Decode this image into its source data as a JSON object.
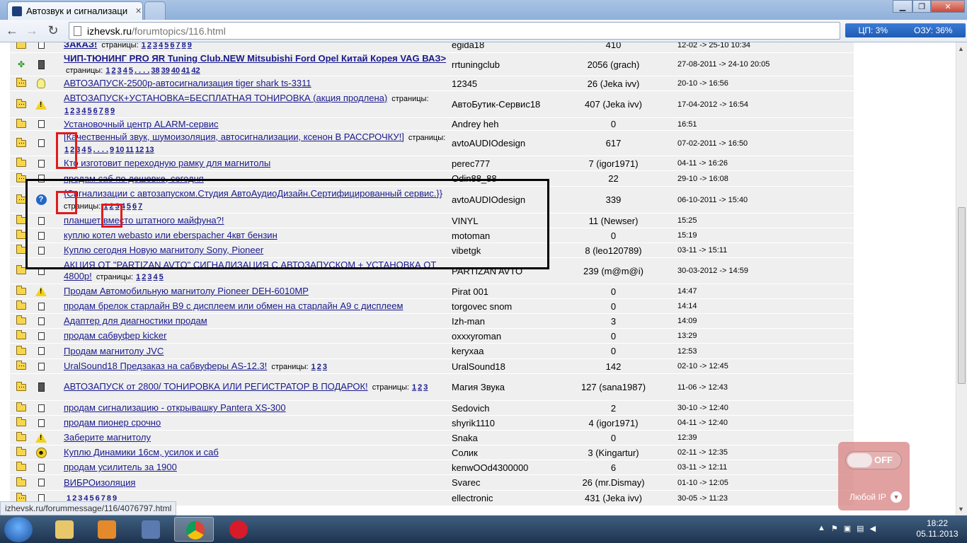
{
  "browser": {
    "tab_title": "Автозвук и сигнализаци",
    "url_host": "izhevsk.ru",
    "url_path": "/forumtopics/116.html"
  },
  "sysmon": {
    "cpu": "ЦП: 3%",
    "ram": "ОЗУ: 36%"
  },
  "rows": [
    {
      "fold": "folder",
      "icon": "doc",
      "title": "ЗАКАЗ!",
      "bold": true,
      "pages": [
        "1",
        "2",
        "3",
        "4",
        "5",
        "6",
        "7",
        "8",
        "9"
      ],
      "author": "egida18",
      "replies": "410",
      "date": "12-02 -> 25-10 10:34",
      "h": 22
    },
    {
      "fold": "clover",
      "icon": "phone",
      "title": "ЧИП-ТЮНИНГ PRO ЯR Tuning Club.NEW Mitsubishi Ford Opel Китай Корея VAG ВАЗ>",
      "bold": true,
      "pages": [
        "1",
        "2",
        "3",
        "4",
        "5",
        ". . . .",
        "38",
        "39",
        "40",
        "41",
        "42"
      ],
      "author": "rrtuningclub",
      "replies": "2056 (grach)",
      "date": "27-08-2011 -> 24-10 20:05",
      "h": 33
    },
    {
      "fold": "folder-dots",
      "icon": "bulb",
      "title": "АВТОЗАПУСК-2500р-автосигнализация tiger shark ts-3311",
      "bold": false,
      "pages": [],
      "author": "12345",
      "replies": "26 (Jeka ivv)",
      "date": "20-10 -> 16:56",
      "h": 21
    },
    {
      "fold": "folder-dots",
      "icon": "warn",
      "title": "АВТОЗАПУСК+УСТАНОВКА=БЕСПЛАТНАЯ ТОНИРОВКА (акция продлена)",
      "bold": false,
      "pages": [
        "1",
        "2",
        "3",
        "4",
        "5",
        "6",
        "7",
        "8",
        "9"
      ],
      "author": "АвтоБутик-Сервис18",
      "replies": "407 (Jeka ivv)",
      "date": "17-04-2012 -> 16:54",
      "h": 38
    },
    {
      "fold": "folder",
      "icon": "doc",
      "title": "Установочный центр ALARM-сервис",
      "bold": false,
      "pages": [],
      "author": "Andrey heh",
      "replies": "0",
      "date": "16:51",
      "h": 18
    },
    {
      "fold": "folder-dots",
      "icon": "doc",
      "title": "[Качественный звук, шумоизоляция, автосигнализации, ксенон В РАССРОЧКУ!]",
      "bold": false,
      "pages": [
        "1",
        "2",
        "3",
        "4",
        "5",
        ". . . .",
        "9",
        "10",
        "11",
        "12",
        "13"
      ],
      "author": "avtoAUDIOdesign",
      "replies": "617",
      "date": "07-02-2011 -> 16:50",
      "h": 36
    },
    {
      "fold": "folder",
      "icon": "doc",
      "title": "Кто изготовит переходную рамку для магнитолы",
      "bold": false,
      "pages": [],
      "author": "perec777",
      "replies": "7 (igor1971)",
      "date": "04-11 -> 16:26",
      "h": 21
    },
    {
      "fold": "folder-dots",
      "icon": "doc",
      "title": "продам саб по дешевке, сегодня",
      "bold": false,
      "pages": [],
      "author": "Odin88_88",
      "replies": "22",
      "date": "29-10 -> 16:08",
      "h": 22
    },
    {
      "fold": "folder-dots",
      "icon": "quest",
      "title": "{Сигнализации с автозапуском.Студия АвтоАудиоДизайн.Сертифицированный сервис.}}",
      "bold": false,
      "pages": [
        "1",
        "2",
        "3",
        "4",
        "5",
        "6",
        "7"
      ],
      "author": "avtoAUDIOdesign",
      "replies": "339",
      "date": "06-10-2011 -> 15:40",
      "h": 38
    },
    {
      "fold": "folder",
      "icon": "doc",
      "title": "планшет вместо штатного майфуна?!",
      "bold": false,
      "pages": [],
      "author": "VINYL",
      "replies": "11 (Newser)",
      "date": "15:25",
      "h": 21
    },
    {
      "fold": "folder",
      "icon": "doc",
      "title": "куплю котел webasto или eberspacher 4квт бензин",
      "bold": false,
      "pages": [],
      "author": "motoman",
      "replies": "0",
      "date": "15:19",
      "h": 21
    },
    {
      "fold": "folder",
      "icon": "doc",
      "title": "Куплю сегодня Новую магнитолу Sony, Pioneer",
      "bold": false,
      "pages": [],
      "author": "vibetgk",
      "replies": "8 (leo120789)",
      "date": "03-11 -> 15:11",
      "h": 21
    },
    {
      "fold": "folder",
      "icon": "doc",
      "title": "АКЦИЯ ОТ \"PARTIZAN AVTO\" СИГНАЛИЗАЦИЯ С АВТОЗАПУСКОМ + УСТАНОВКА ОТ 4800р!",
      "bold": false,
      "pages": [
        "1",
        "2",
        "3",
        "4",
        "5"
      ],
      "author": "PARTIZAN AVTO",
      "replies": "239 (m@m@i)",
      "date": "30-03-2012 -> 14:59",
      "h": 37
    },
    {
      "fold": "folder",
      "icon": "warn",
      "title": "Продам Автомобильную магнитолу Pioneer DEH-6010MP",
      "bold": false,
      "pages": [],
      "author": "Pirat 001",
      "replies": "0",
      "date": "14:47",
      "h": 21
    },
    {
      "fold": "folder",
      "icon": "doc",
      "title": "продам брелок старлайн В9 с дисплеем или обмен на старлайн А9 с дисплеем",
      "bold": false,
      "pages": [],
      "author": "torgovec snom",
      "replies": "0",
      "date": "14:14",
      "h": 21
    },
    {
      "fold": "folder",
      "icon": "doc",
      "title": "Адаптер для диагностики продам",
      "bold": false,
      "pages": [],
      "author": "Izh-man",
      "replies": "3",
      "date": "14:09",
      "h": 21
    },
    {
      "fold": "folder",
      "icon": "doc",
      "title": "продам сабвуфер kicker",
      "bold": false,
      "pages": [],
      "author": "oxxxyroman",
      "replies": "0",
      "date": "13:29",
      "h": 21
    },
    {
      "fold": "folder",
      "icon": "doc",
      "title": "Продам магнитолу JVC",
      "bold": false,
      "pages": [],
      "author": "keryxaa",
      "replies": "0",
      "date": "12:53",
      "h": 22
    },
    {
      "fold": "folder-dots",
      "icon": "doc",
      "title": "UralSound18 Предзаказ на сабвуферы AS-12.3!",
      "bold": false,
      "pages": [
        "1",
        "2",
        "3"
      ],
      "author": "UralSound18",
      "replies": "142",
      "date": "02-10 -> 12:45",
      "h": 21
    },
    {
      "fold": "folder-dots",
      "icon": "phone",
      "title": "АВТОЗАПУСК от 2800/ ТОНИРОВКА ИЛИ РЕГИСТРАТОР В ПОДАРОК!",
      "bold": false,
      "pages": [
        "1",
        "2",
        "3"
      ],
      "author": "Магия Звука",
      "replies": "127 (sana1987)",
      "date": "11-06 -> 12:43",
      "h": 38
    },
    {
      "fold": "folder",
      "icon": "doc",
      "title": "продам сигнализацию - открывашку Pantera XS-300",
      "bold": false,
      "pages": [],
      "author": "Sedovich",
      "replies": "2",
      "date": "30-10 -> 12:40",
      "h": 21
    },
    {
      "fold": "folder",
      "icon": "doc",
      "title": "продам пионер срочно",
      "bold": false,
      "pages": [],
      "author": "shyrik1110",
      "replies": "4 (igor1971)",
      "date": "04-11 -> 12:40",
      "h": 21
    },
    {
      "fold": "folder",
      "icon": "warn",
      "title": "Заберите магнитолу",
      "bold": false,
      "pages": [],
      "author": "Snaka",
      "replies": "0",
      "date": "12:39",
      "h": 21
    },
    {
      "fold": "folder",
      "icon": "smile",
      "title": "Куплю Динамики 16см, усилок и саб",
      "bold": false,
      "pages": [],
      "author": "Солик",
      "replies": "3 (Kingartur)",
      "date": "02-11 -> 12:35",
      "h": 21
    },
    {
      "fold": "folder",
      "icon": "doc",
      "title": "продам усилитель за 1900",
      "bold": false,
      "pages": [],
      "author": "kenwOOd4300000",
      "replies": "6",
      "date": "03-11 -> 12:11",
      "h": 21
    },
    {
      "fold": "folder",
      "icon": "doc",
      "title": "ВИБРОизоляция",
      "bold": false,
      "pages": [],
      "author": "Svarec",
      "replies": "26 (mr.Dismay)",
      "date": "01-10 -> 12:05",
      "h": 22
    },
    {
      "fold": "folder-dots",
      "icon": "doc",
      "title": "",
      "bold": false,
      "pages": [
        "1",
        "2",
        "3",
        "4",
        "5",
        "6",
        "7",
        "8",
        "9"
      ],
      "author": "ellectronic",
      "replies": "431 (Jeka ivv)",
      "date": "30-05 -> 11:23",
      "h": 22
    }
  ],
  "statusbar": {
    "url": "izhevsk.ru/forummessage/116/4076797.html"
  },
  "vpn": {
    "toggle": "OFF",
    "ip": "Любой IP"
  },
  "clock": {
    "time": "18:22",
    "date": "05.11.2013"
  }
}
